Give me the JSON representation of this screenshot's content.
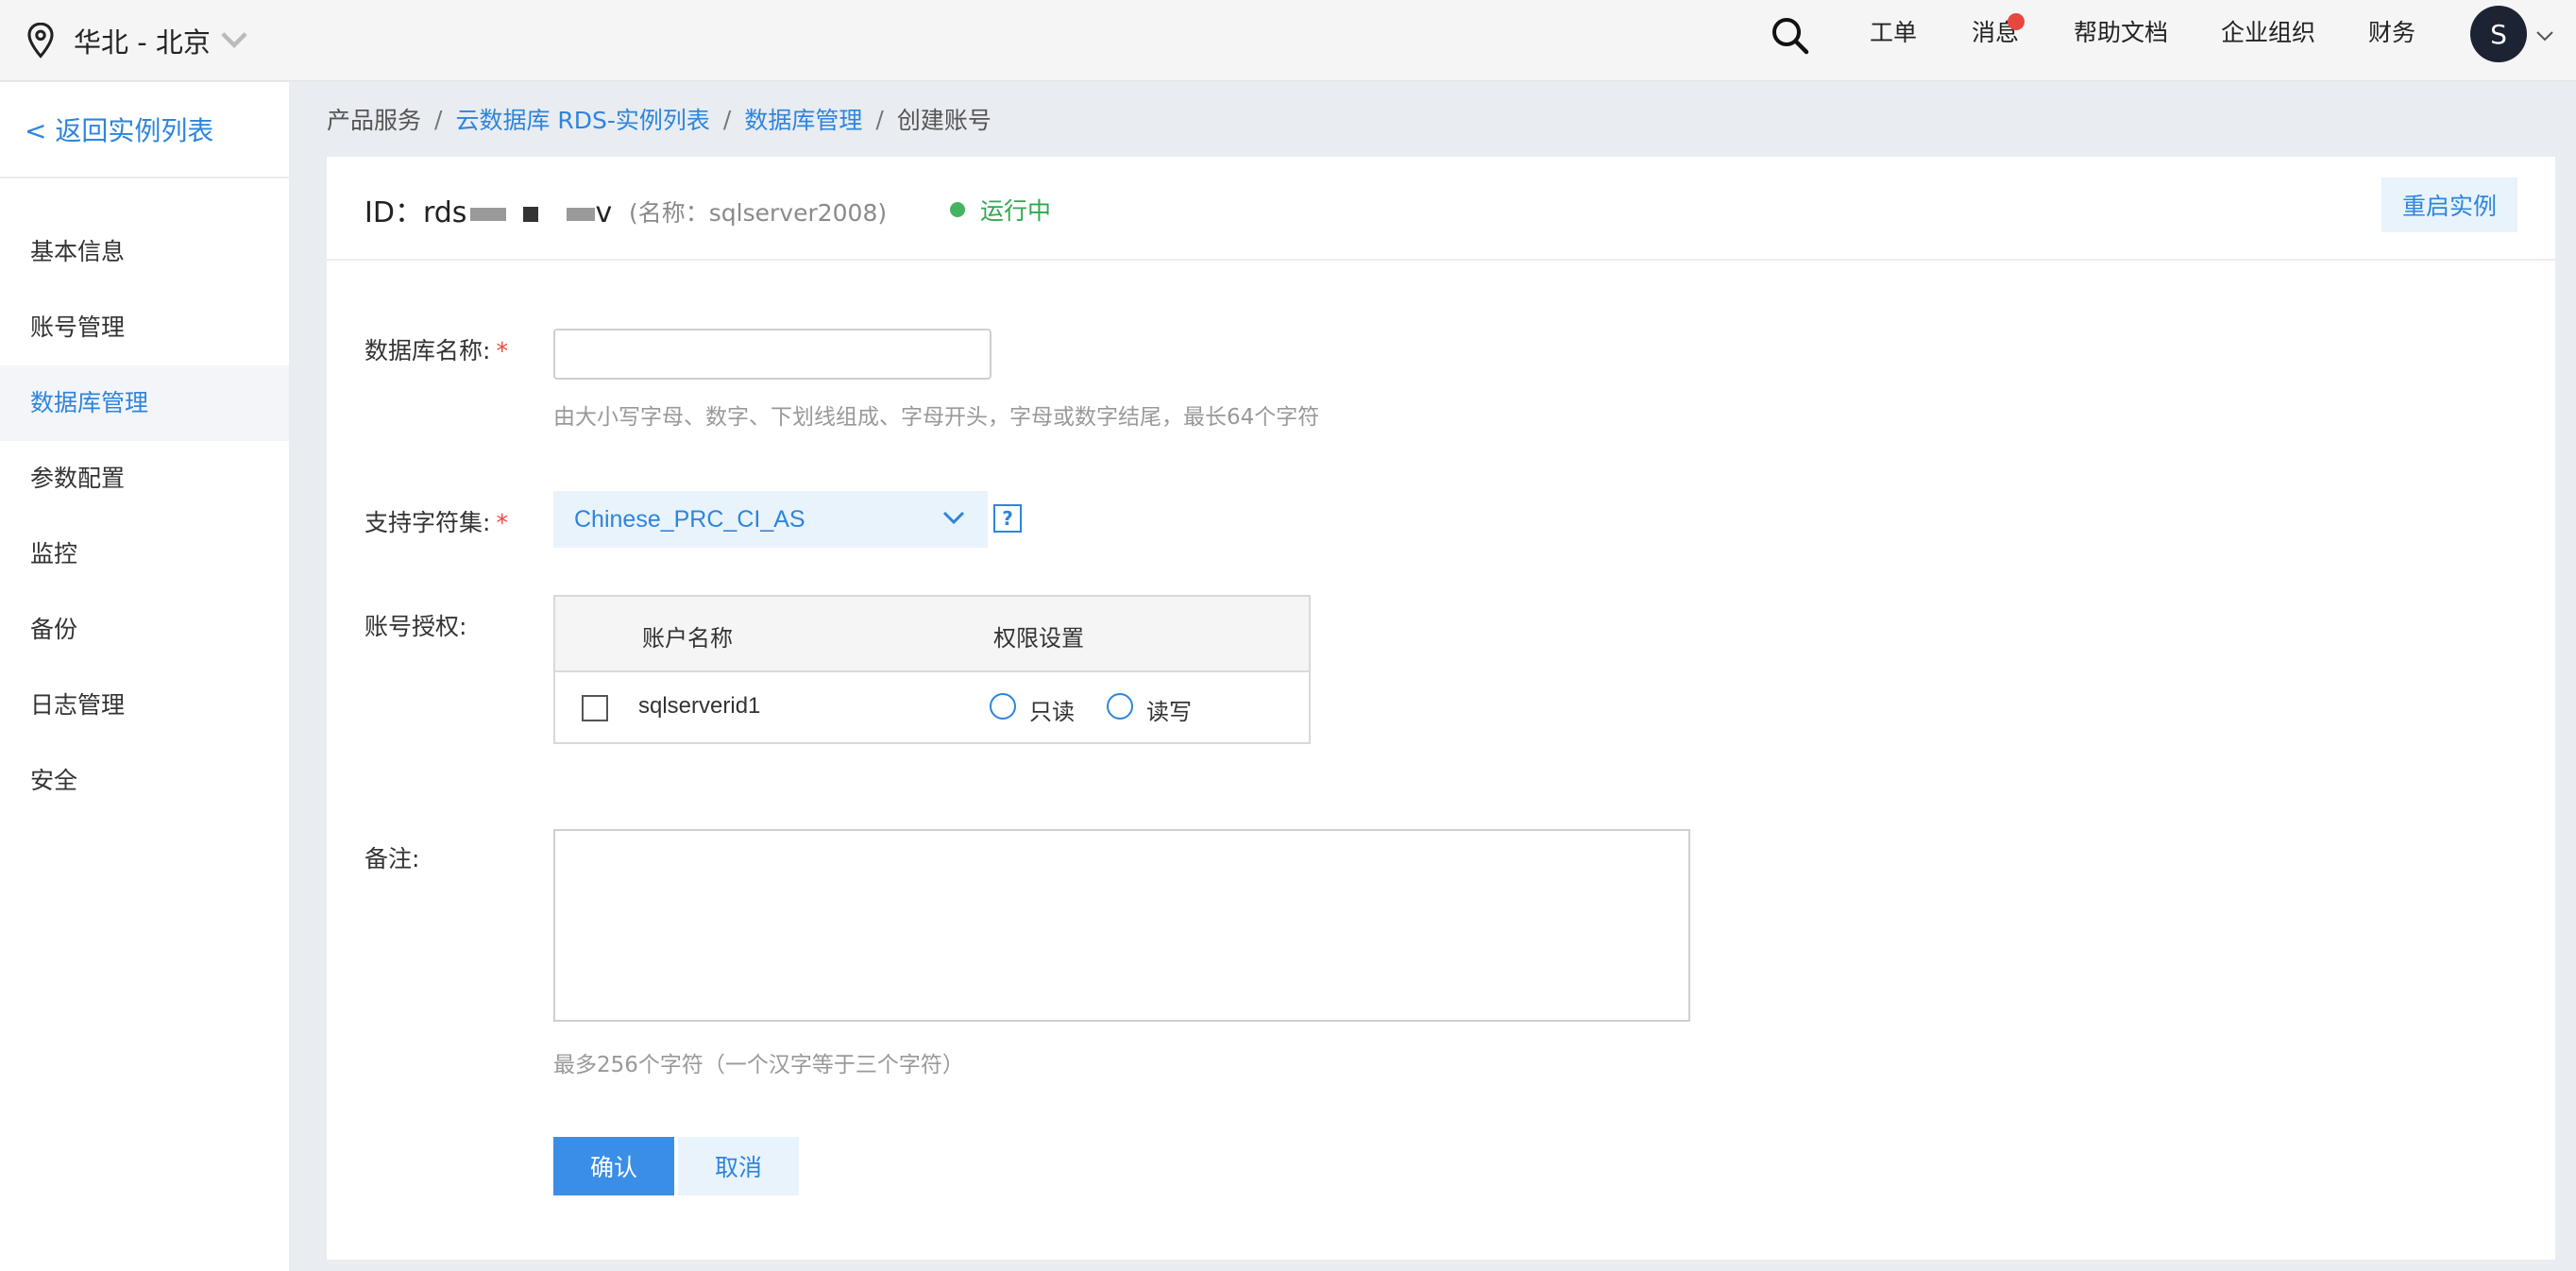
{
  "topbar": {
    "region": "华北 - 北京",
    "nav": [
      "工单",
      "消息",
      "帮助文档",
      "企业组织",
      "财务"
    ],
    "avatar_letter": "S"
  },
  "sidebar": {
    "back_label": "< 返回实例列表",
    "items": [
      "基本信息",
      "账号管理",
      "数据库管理",
      "参数配置",
      "监控",
      "备份",
      "日志管理",
      "安全"
    ],
    "active_item": "数据库管理"
  },
  "breadcrumb": {
    "items": [
      "产品服务",
      "云数据库 RDS-实例列表",
      "数据库管理",
      "创建账号"
    ],
    "separator": "/"
  },
  "instance": {
    "id_prefix": "ID：rds",
    "id_suffix": "v",
    "name_text": "(名称：sqlserver2008)",
    "status": "运行中",
    "restart_label": "重启实例"
  },
  "form": {
    "db_name_label": "数据库名称:",
    "db_name_value": "",
    "db_name_hint": "由大小写字母、数字、下划线组成、字母开头，字母或数字结尾，最长64个字符",
    "charset_label": "支持字符集:",
    "charset_value": "Chinese_PRC_CI_AS",
    "help_symbol": "?",
    "required_mark": "*",
    "auth_label": "账号授权:",
    "table": {
      "col_account": "账户名称",
      "col_permission": "权限设置",
      "rows": [
        {
          "account": "sqlserverid1",
          "options": [
            "只读",
            "读写"
          ]
        }
      ]
    },
    "remark_label": "备注:",
    "remark_value": "",
    "remark_hint": "最多256个字符（一个汉字等于三个字符）",
    "confirm_label": "确认",
    "cancel_label": "取消"
  },
  "colors": {
    "accent": "#2d85dd",
    "primary_button": "#3a8ee6",
    "status_green": "#45b35f",
    "required_red": "#e8473e",
    "page_bg": "#e9ecf0"
  }
}
